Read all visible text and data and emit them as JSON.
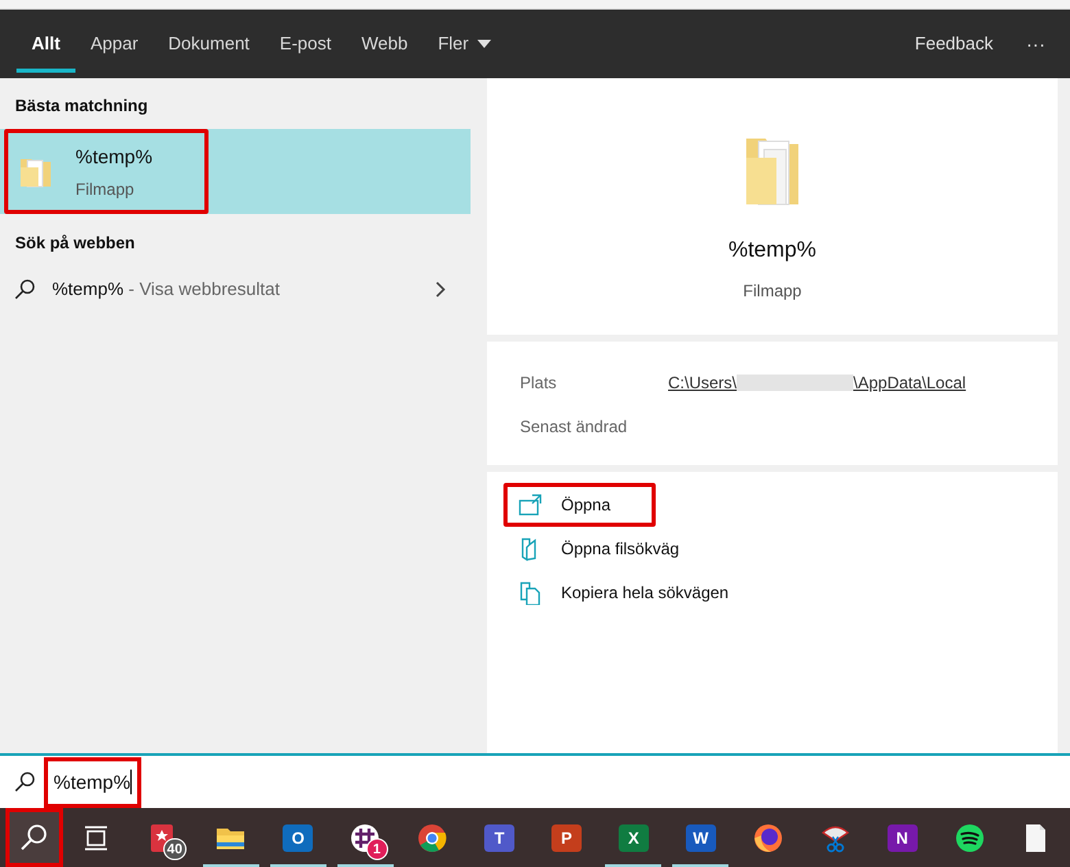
{
  "tabs": [
    {
      "label": "Allt",
      "selected": true
    },
    {
      "label": "Appar",
      "selected": false
    },
    {
      "label": "Dokument",
      "selected": false
    },
    {
      "label": "E-post",
      "selected": false
    },
    {
      "label": "Webb",
      "selected": false
    },
    {
      "label": "Fler",
      "selected": false,
      "dropdown": true
    }
  ],
  "header_actions": {
    "feedback": "Feedback",
    "more": "···"
  },
  "best_match": {
    "heading": "Bästa matchning",
    "title": "%temp%",
    "subtitle": "Filmapp",
    "selected": true,
    "highlighted": true
  },
  "web_search": {
    "heading": "Sök på webben",
    "query": "%temp%",
    "suffix": " - Visa webbresultat"
  },
  "preview": {
    "title": "%temp%",
    "subtitle": "Filmapp",
    "details": [
      {
        "label": "Plats",
        "kind": "path",
        "path_start": "C:\\Users\\",
        "path_end": "\\AppData\\Local"
      },
      {
        "label": "Senast ändrad",
        "kind": "plain"
      }
    ],
    "actions": [
      {
        "label": "Öppna",
        "kind": "open",
        "highlighted": true
      },
      {
        "label": "Öppna filsökväg",
        "kind": "folder",
        "highlighted": false
      },
      {
        "label": "Kopiera hela sökvägen",
        "kind": "copy",
        "highlighted": false
      }
    ]
  },
  "search_box": {
    "value": "%temp%",
    "highlighted": true
  },
  "taskbar": [
    {
      "kind": "search",
      "highlighted": true,
      "running": false
    },
    {
      "kind": "taskview",
      "running": false
    },
    {
      "kind": "bookmark",
      "badge": "40",
      "running": false
    },
    {
      "kind": "folder",
      "running": true
    },
    {
      "kind": "letter",
      "letter": "O",
      "color": "#0f6cbd",
      "running": true
    },
    {
      "kind": "hash",
      "badge": "1",
      "running": true
    },
    {
      "kind": "browser",
      "running": false
    },
    {
      "kind": "letter",
      "letter": "T",
      "color": "#5059c9",
      "running": false
    },
    {
      "kind": "letter",
      "letter": "P",
      "color": "#c43e1c",
      "running": false
    },
    {
      "kind": "letter",
      "letter": "X",
      "color": "#107c41",
      "running": true
    },
    {
      "kind": "letter",
      "letter": "W",
      "color": "#185abd",
      "running": true
    },
    {
      "kind": "fox",
      "running": false
    },
    {
      "kind": "scissors",
      "running": false
    },
    {
      "kind": "letter",
      "letter": "N",
      "color": "#7719aa",
      "running": false
    },
    {
      "kind": "music",
      "running": false
    },
    {
      "kind": "document",
      "running": false
    }
  ]
}
